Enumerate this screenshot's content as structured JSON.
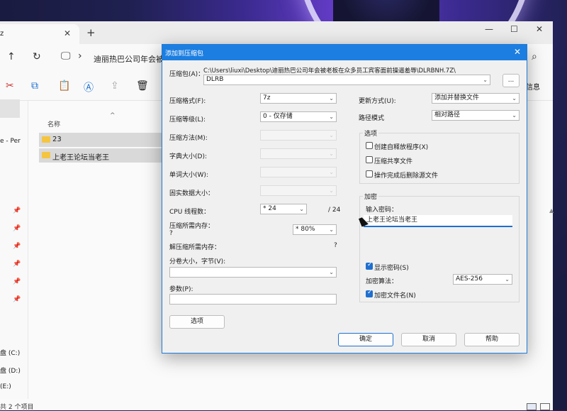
{
  "explorer": {
    "tab_title": "z",
    "address_text": "迪丽热巴公司年会被",
    "toolbar_info": "信息",
    "column_name": "名称",
    "files": [
      {
        "name": "23"
      },
      {
        "name": "上老王论坛当老王"
      }
    ],
    "sidebar_partial": "e - Per",
    "drives": [
      "盘 (C:)",
      "盘 (D:)",
      "(E:)"
    ],
    "status_text": "共 2 个项目"
  },
  "dialog": {
    "title": "添加到压缩包",
    "archive_label": "压缩包(A)：",
    "archive_path": "C:\\Users\\liuxi\\Desktop\\迪丽热巴公司年会被老板在众多员工宾客面前操逼羞辱\\DLRBNH.7Z\\",
    "archive_name": "DLRB",
    "browse_label": "...",
    "format_label": "压缩格式(F):",
    "format_value": "7z",
    "level_label": "压缩等级(L):",
    "level_value": "0 - 仅存储",
    "method_label": "压缩方法(M):",
    "dict_label": "字典大小(D):",
    "word_label": "单词大小(W):",
    "solid_label": "固实数据大小：",
    "cpu_label": "CPU 线程数：",
    "cpu_value": "* 24",
    "cpu_total": "/ 24",
    "mem_comp_label": "压缩所需内存：",
    "mem_comp_value": "?",
    "mem_pct": "* 80%",
    "mem_decomp_label": "解压缩所需内存：",
    "mem_decomp_value": "?",
    "split_label": "分卷大小，字节(V):",
    "params_label": "参数(P):",
    "options_btn": "选项",
    "update_label": "更新方式(U):",
    "update_value": "添加并替换文件",
    "path_label": "路径模式",
    "path_value": "相对路径",
    "options_group": "选项",
    "opt_sfx": "创建自释放程序(X)",
    "opt_shared": "压缩共享文件",
    "opt_delete": "操作完成后删除源文件",
    "encrypt_group": "加密",
    "password_label": "输入密码：",
    "password_value": "上老王论坛当老王",
    "show_pwd": "显示密码(S)",
    "enc_method_label": "加密算法：",
    "enc_method_value": "AES-256",
    "enc_names": "加密文件名(N)",
    "ok": "确定",
    "cancel": "取消",
    "help": "帮助"
  },
  "colors": {
    "accent": "#1c7ee0",
    "folder": "#f5c542"
  }
}
